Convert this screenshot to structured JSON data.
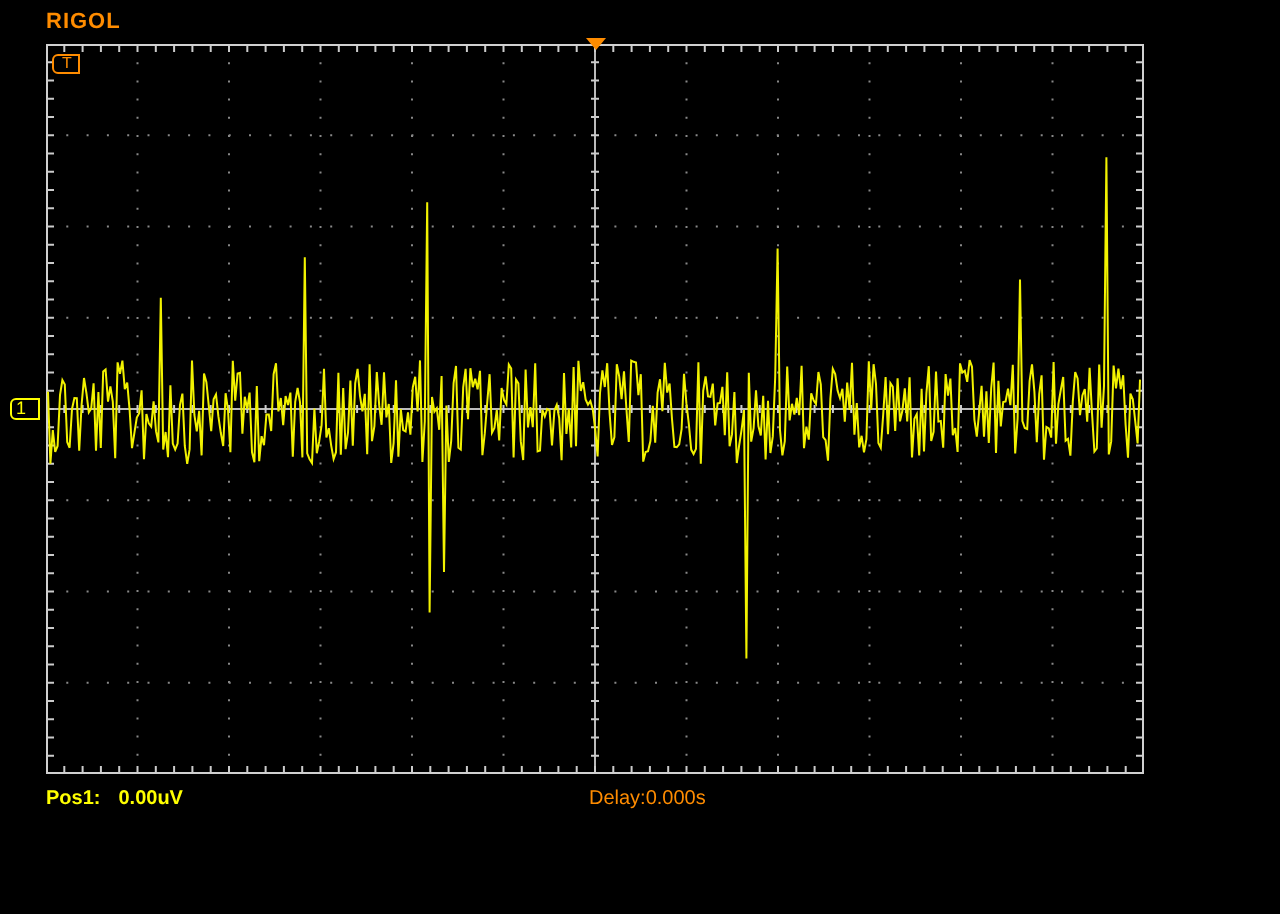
{
  "header": {
    "logo": "RIGOL"
  },
  "screen": {
    "trigger_marker": "T",
    "channel_marker": "1"
  },
  "status_bar": {
    "position_label": "Pos1:",
    "position_value": "0.00uV",
    "delay": "Delay:0.000s"
  }
}
